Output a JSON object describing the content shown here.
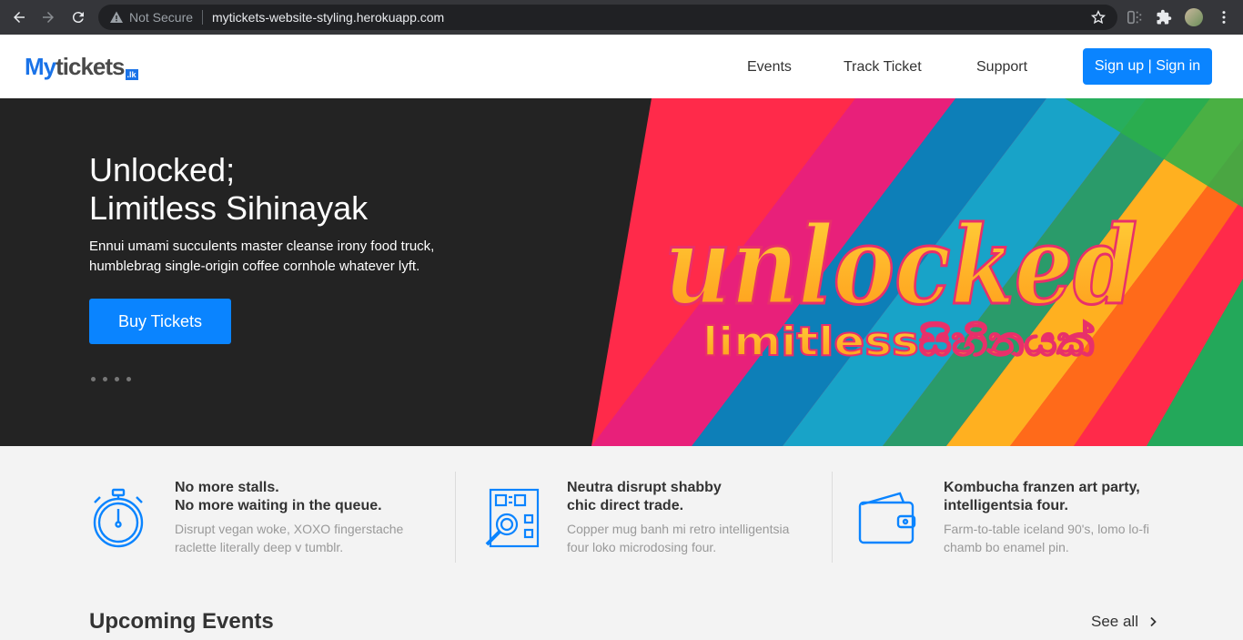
{
  "browser": {
    "security_label": "Not Secure",
    "url": "mytickets-website-styling.herokuapp.com",
    "icons": [
      "back-icon",
      "forward-icon",
      "reload-icon",
      "warning-icon",
      "star-icon",
      "extension-icon",
      "puzzle-icon",
      "avatar",
      "menu-icon"
    ]
  },
  "header": {
    "logo_my": "My",
    "logo_tickets": "tickets",
    "logo_tld": ".lk",
    "nav": [
      "Events",
      "Track Ticket",
      "Support"
    ],
    "cta": "Sign up | Sign in"
  },
  "hero": {
    "title_line1": "Unlocked;",
    "title_line2": "Limitless Sihinayak",
    "text": "Ennui umami succulents master cleanse irony food truck, humblebrag single-origin coffee cornhole whatever lyft.",
    "button": "Buy Tickets",
    "art_word": "unlocked",
    "art_sub": "limitlessසිහිනයක්",
    "slides": 4
  },
  "features": [
    {
      "icon": "stopwatch-icon",
      "title1": "No more stalls.",
      "title2": "No more waiting in the queue.",
      "desc1": "Disrupt vegan woke, XOXO fingerstache",
      "desc2": "raclette literally deep v tumblr."
    },
    {
      "icon": "qr-scan-icon",
      "title1": "Neutra disrupt shabby",
      "title2": "chic direct trade.",
      "desc1": "Copper mug banh mi retro intelligentsia",
      "desc2": "four loko microdosing four."
    },
    {
      "icon": "wallet-icon",
      "title1": "Kombucha franzen art party,",
      "title2": "intelligentsia four.",
      "desc1": "Farm-to-table iceland 90's, lomo lo-fi",
      "desc2": "chamb bo enamel pin."
    }
  ],
  "upcoming": {
    "title": "Upcoming Events",
    "see_all": "See all"
  },
  "colors": {
    "accent": "#0a84ff",
    "hero_bg": "#232323"
  }
}
